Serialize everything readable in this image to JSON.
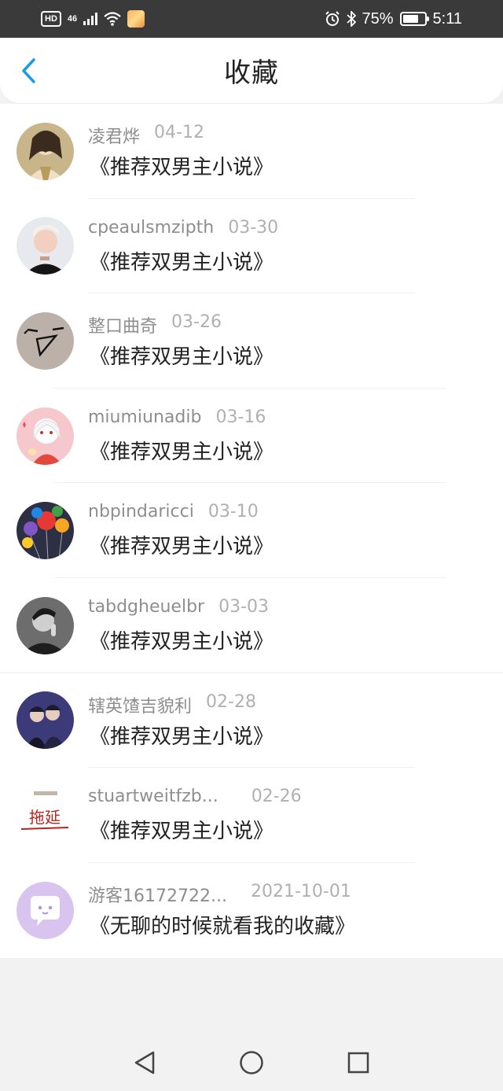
{
  "status_bar": {
    "hd": "HD",
    "network": "46",
    "battery_percent": "75%",
    "battery_level": 0.75,
    "time": "5:11",
    "icons": [
      "signal-icon",
      "wifi-icon",
      "app-notification-icon",
      "alarm-icon",
      "bluetooth-icon",
      "battery-icon"
    ]
  },
  "header": {
    "title": "收藏",
    "back_icon": "chevron-left-icon"
  },
  "favorites": [
    {
      "user": "凌君烨",
      "date": "04-12",
      "title": "《推荐双男主小说》"
    },
    {
      "user": "cpeaulsmzipth",
      "date": "03-30",
      "title": "《推荐双男主小说》"
    },
    {
      "user": "整口曲奇",
      "date": "03-26",
      "title": "《推荐双男主小说》"
    },
    {
      "user": "miumiunadib",
      "date": "03-16",
      "title": "《推荐双男主小说》"
    },
    {
      "user": "nbpindaricci",
      "date": "03-10",
      "title": "《推荐双男主小说》"
    },
    {
      "user": "tabdgheuelbr",
      "date": "03-03",
      "title": "《推荐双男主小说》"
    },
    {
      "user": "辖英馇吉貌利",
      "date": "02-28",
      "title": "《推荐双男主小说》"
    },
    {
      "user": "stuartweitfzb...",
      "date": "02-26",
      "title": "《推荐双男主小说》"
    },
    {
      "user": "游客16172722...",
      "date": "2021-10-01",
      "title": "《无聊的时候就看我的收藏》"
    }
  ],
  "avatar_logo_text": "拖延",
  "nav_bar": {
    "icons": [
      "back-triangle-icon",
      "home-circle-icon",
      "recents-square-icon"
    ]
  }
}
